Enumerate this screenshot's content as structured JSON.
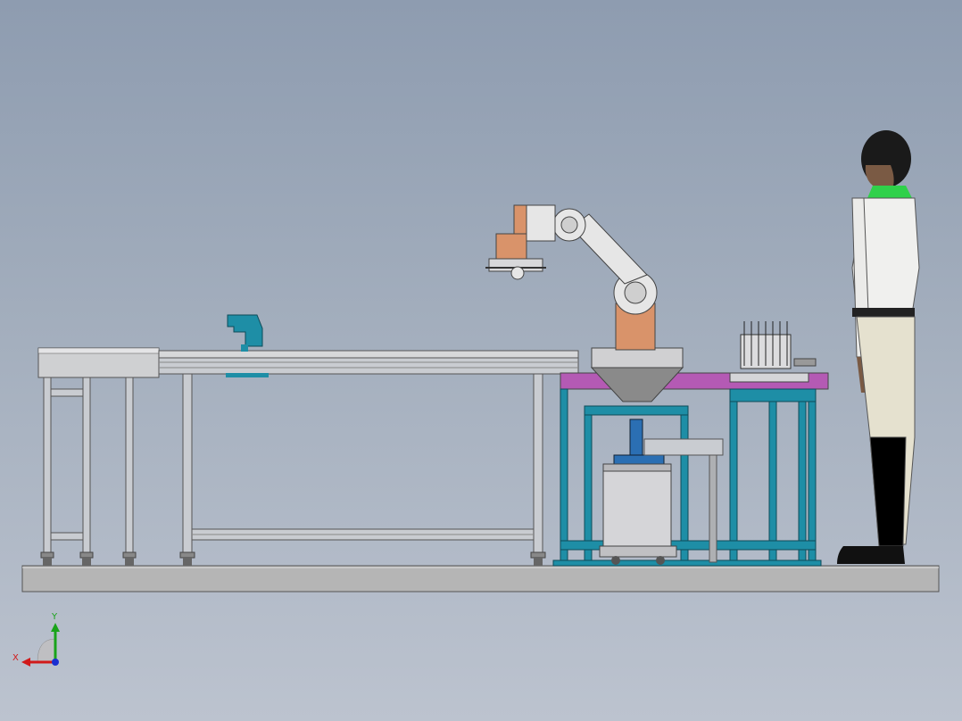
{
  "triad": {
    "x_label": "X",
    "y_label": "Y"
  },
  "colors": {
    "background_top": "#8e9cb0",
    "background_bottom": "#bcc3cf",
    "frame_steel": "#c9ccd1",
    "frame_teal": "#1e8ea6",
    "plate_magenta": "#b45ab4",
    "hopper_grey": "#8a8a8a",
    "robot_white": "#e6e6e6",
    "robot_copper": "#d9936a",
    "floor_plate": "#b5b5b5",
    "axis_x": "#d11a1a",
    "axis_y": "#1aa31a",
    "axis_z": "#1a2fd1"
  },
  "icons": {
    "triad": "coordinate-triad-icon"
  }
}
